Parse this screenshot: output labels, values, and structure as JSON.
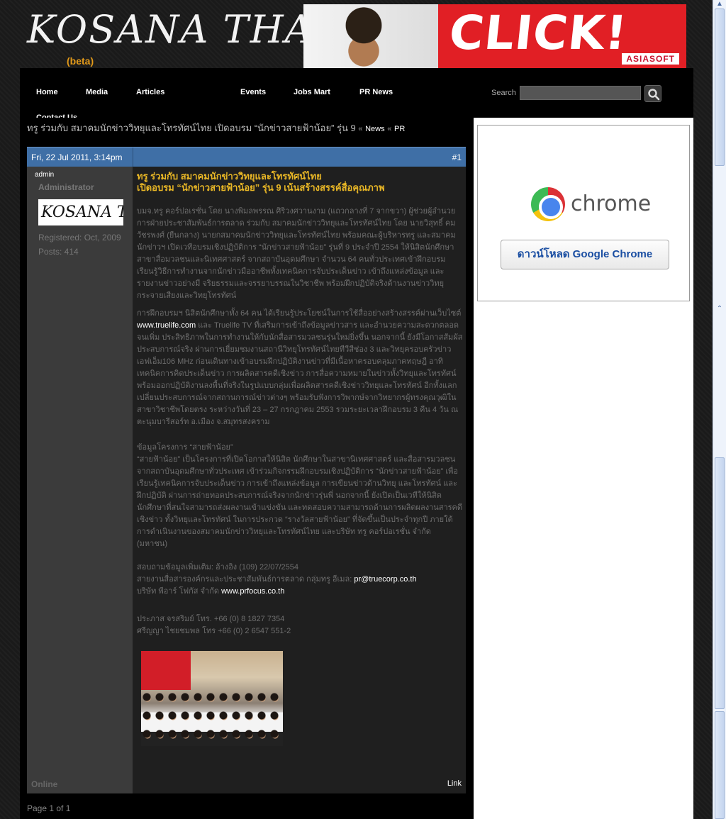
{
  "header": {
    "logo_text": "KOSANA THAI",
    "logo_tag": "(beta)",
    "banner_text": "CLICK!",
    "banner_brand": "ASIASOFT"
  },
  "nav": {
    "items": [
      "Home",
      "Media",
      "Articles",
      "Events",
      "Jobs Mart",
      "PR News",
      "Contact Us"
    ],
    "search_label": "Search",
    "search_placeholder": ""
  },
  "breadcrumb": {
    "title": "ทรู ร่วมกับ สมาคมนักข่าววิทยุและโทรทัศน์ไทย เปิดอบรม “นักข่าวสายฟ้าน้อย” รุ่น 9",
    "sep": "«",
    "news": "News",
    "pr": "PR"
  },
  "post": {
    "date": "Fri, 22 Jul 2011, 3:14pm",
    "number": "#1",
    "title_line1": "ทรู ร่วมกับ สมาคมนักข่าววิทยุและโทรทัศน์ไทย",
    "title_line2": "เปิดอบรม “นักข่าวสายฟ้าน้อย” รุ่น 9 เน้นสร้างสรรค์สื่อคุณภาพ",
    "para1": "บมจ.ทรู คอร์ปอเรชั่น โดย นางพิมลพรรณ ศิริวงศวานงาม (แถวกลางที่ 7 จากขวา) ผู้ช่วยผู้อำนวยการฝ่ายประชาสัมพันธ์การตลาด ร่วมกับ สมาคมนักข่าววิทยุและโทรทัศน์ไทย โดย นายวิสุทธิ์ คมวัชรพงศ์ (ยืนกลาง) นายกสมาคมนักข่าววิทยุและโทรทัศน์ไทย พร้อมคณะผู้บริหารทรู และสมาคมนักข่าวฯ เปิดเวทีอบรมเชิงปฏิบัติการ “นักข่าวสายฟ้าน้อย” รุ่นที่ 9 ประจำปี 2554 ให้นิสิตนักศึกษา สาขาสื่อมวลชนและนิเทศศาสตร์ จากสถาบันอุดมศึกษา จำนวน 64 คนทั่วประเทศเข้าฝึกอบรม เรียนรู้วิธีการทำงานจากนักข่าวมืออาชีพทั้งเทคนิคการจับประเด็นข่าว เข้าถึงแหล่งข้อมูล และรายงานข่าวอย่างมี จริยธรรมและจรรยาบรรณในวิชาชีพ พร้อมฝึกปฏิบัติจริงด้านงานข่าววิทยุ กระจายเสียงและวิทยุโทรทัศน์",
    "para2_a": "การฝึกอบรมฯ นิสิตนักศึกษาทั้ง 64 คน ได้เรียนรู้ประโยชน์ในการใช้สื่ออย่างสร้างสรรค์ผ่านเว็บไซต์",
    "para2_link": "www.truelife.com",
    "para2_b": "และ Truelife TV ที่เสริมการเข้าถึงข้อมูลข่าวสาร และอำนวยความสะดวกตลอดจนเพิ่ม ประสิทธิภาพในการทำงานให้กับนักสื่อสารมวลชนรุ่นใหม่ยิ่งขึ้น นอกจากนี้ ยังมีโอกาสสัมผัสประสบการณ์จริง ผ่านการเยี่ยมชมงานสถานีวิทยุโทรทัศน์ไทยทีวีสีช่อง 3 และวิทยุครอบครัวข่าว เอฟเอ็ม106 MHz ก่อนเดินทางเข้าอบรมฝึกปฏิบัติงานข่าวที่มีเนื้อหาครอบคลุมภาคทฤษฎี อาทิ เทคนิคการคิดประเด็นข่าว การผลิตสารคดีเชิงข่าว การสื่อความหมายในข่าวทั้งวิทยุและโทรทัศน์ พร้อมออกปฏิบัติงานลงพื้นที่จริงในรูปแบบกลุ่มเพื่อผลิตสารคดีเชิงข่าววิทยุและโทรทัศน์ อีกทั้งแลกเปลี่ยนประสบการณ์จากสถานการณ์ข่าวต่างๆ พร้อมรับฟังการวิพากษ์จากวิทยากรผู้ทรงคุณวุฒิในสาขาวิชาชีพโดยตรง ระหว่างวันที่ 23 – 27 กรกฎาคม 2553 รวมระยะเวลาฝึกอบรม 3 คืน 4 วัน ณ ตะนุมบารีสอร์ท อ.เมือง จ.สมุทรสงคราม",
    "para3": "ข้อมูลโครงการ “สายฟ้าน้อย”\n“สายฟ้าน้อย” เป็นโครงการที่เปิดโอกาสให้นิสิต นักศึกษาในสาขานิเทศศาสตร์ และสื่อสารมวลชน จากสถาบันอุดมศึกษาทั่วประเทศ เข้าร่วมกิจกรรมฝึกอบรมเชิงปฏิบัติการ “นักข่าวสายฟ้าน้อย” เพื่อเรียนรู้เทคนิคการจับประเด็นข่าว การเข้าถึงแหล่งข้อมูล การเขียนข่าวด้านวิทยุ และโทรทัศน์ และฝึกปฏิบัติ ผ่านการถ่ายทอดประสบการณ์จริงจากนักข่าวรุ่นพี่ นอกจากนี้ ยังเปิดเป็นเวทีให้นิสิตนักศึกษาที่สนใจสามารถส่งผลงานเข้าแข่งขัน และทดสอบความสามารถด้านการผลิตผลงานสารคดี เชิงข่าว ทั้งวิทยุและโทรทัศน์ ในการประกวด “รางวัลสายฟ้าน้อย” ที่จัดขึ้นเป็นประจำทุกปี ภายใต้การดำเนินงานของสมาคมนักข่าววิทยุและโทรทัศน์ไทย และบริษัท ทรู คอร์ปอเรชั่น จำกัด (มหาชน)",
    "contact1": "สอบถามข้อมูลเพิ่มเติม: อ้างอิง (109) 22/07/2554",
    "contact2": "สายงานสื่อสารองค์กรและประชาสัมพันธ์การตลาด กลุ่มทรู อีเมล:",
    "contact2_link": "pr@truecorp.co.th",
    "contact3": "บริษัท พีอาร์ โฟกัส จำกัด",
    "contact3_link": "www.prfocus.co.th",
    "phone1": "ประภาส จรสริมย์ โทร. +66 (0) 8 1827 7354",
    "phone2": "ศรีญญา ไชยชมพล โทร +66 (0) 2 6547 551-2",
    "link_label": "Link"
  },
  "user": {
    "name": "admin",
    "title": "Administrator",
    "avatar_text": "KOSANA THAI",
    "registered": "Registered: Oct, 2009",
    "posts": "Posts: 414",
    "status": "Online"
  },
  "pager": "Page 1 of 1",
  "ad": {
    "chrome_word": "chrome",
    "button_label": "ดาวน์โหลด Google Chrome"
  }
}
